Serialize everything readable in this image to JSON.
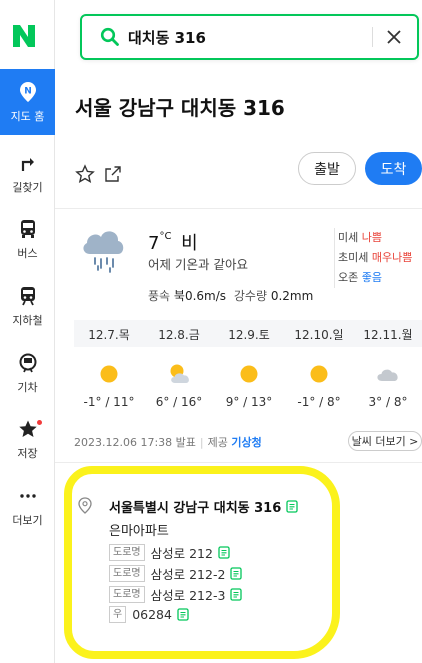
{
  "app": {
    "logo_letter": "N",
    "brand_color": "#03c75a",
    "accent_color": "#1f7cf3"
  },
  "rail": {
    "items": [
      {
        "label": "지도 홈",
        "icon": "map-pin-icon",
        "active": true
      },
      {
        "label": "길찾기",
        "icon": "turn-arrow-icon"
      },
      {
        "label": "버스",
        "icon": "bus-icon"
      },
      {
        "label": "지하철",
        "icon": "subway-icon"
      },
      {
        "label": "기차",
        "icon": "train-icon"
      },
      {
        "label": "저장",
        "icon": "star-icon",
        "has_badge": true
      },
      {
        "label": "더보기",
        "icon": "more-dots-icon"
      }
    ]
  },
  "search": {
    "query": "대치동 316"
  },
  "place": {
    "title": "서울 강남구 대치동 316"
  },
  "actions": {
    "start_label": "출발",
    "arrive_label": "도착"
  },
  "weather": {
    "temp": "7",
    "unit": "°C",
    "condition": "비",
    "compare": "어제 기온과 같아요",
    "wind_label": "풍속",
    "wind_value": "북0.6m/s",
    "rain_label": "강수량",
    "rain_value": "0.2mm",
    "air": [
      {
        "label": "미세",
        "value": "나쁨",
        "status": "bad"
      },
      {
        "label": "초미세",
        "value": "매우나쁨",
        "status": "bad"
      },
      {
        "label": "오존",
        "value": "좋음",
        "status": "good"
      }
    ],
    "forecast": [
      {
        "date": "12.7.목",
        "icon": "sun-icon",
        "temps": "-1° / 11°"
      },
      {
        "date": "12.8.금",
        "icon": "partly-cloudy-icon",
        "temps": "6° / 16°"
      },
      {
        "date": "12.9.토",
        "icon": "sun-icon",
        "temps": "9° / 13°"
      },
      {
        "date": "12.10.일",
        "icon": "sun-icon",
        "temps": "-1° / 8°"
      },
      {
        "date": "12.11.월",
        "icon": "cloud-icon",
        "temps": "3° / 8°"
      }
    ],
    "issued": "2023.12.06 17:38 발표",
    "provider_label": "제공",
    "provider": "기상청",
    "more_label": "날씨 더보기 >"
  },
  "address": {
    "jibun": "서울특별시 강남구 대치동 316",
    "building": "은마아파트",
    "road_tag": "도로명",
    "roads": [
      "삼성로 212",
      "삼성로 212-2",
      "삼성로 212-3"
    ],
    "zip_tag": "우",
    "zip": "06284"
  }
}
